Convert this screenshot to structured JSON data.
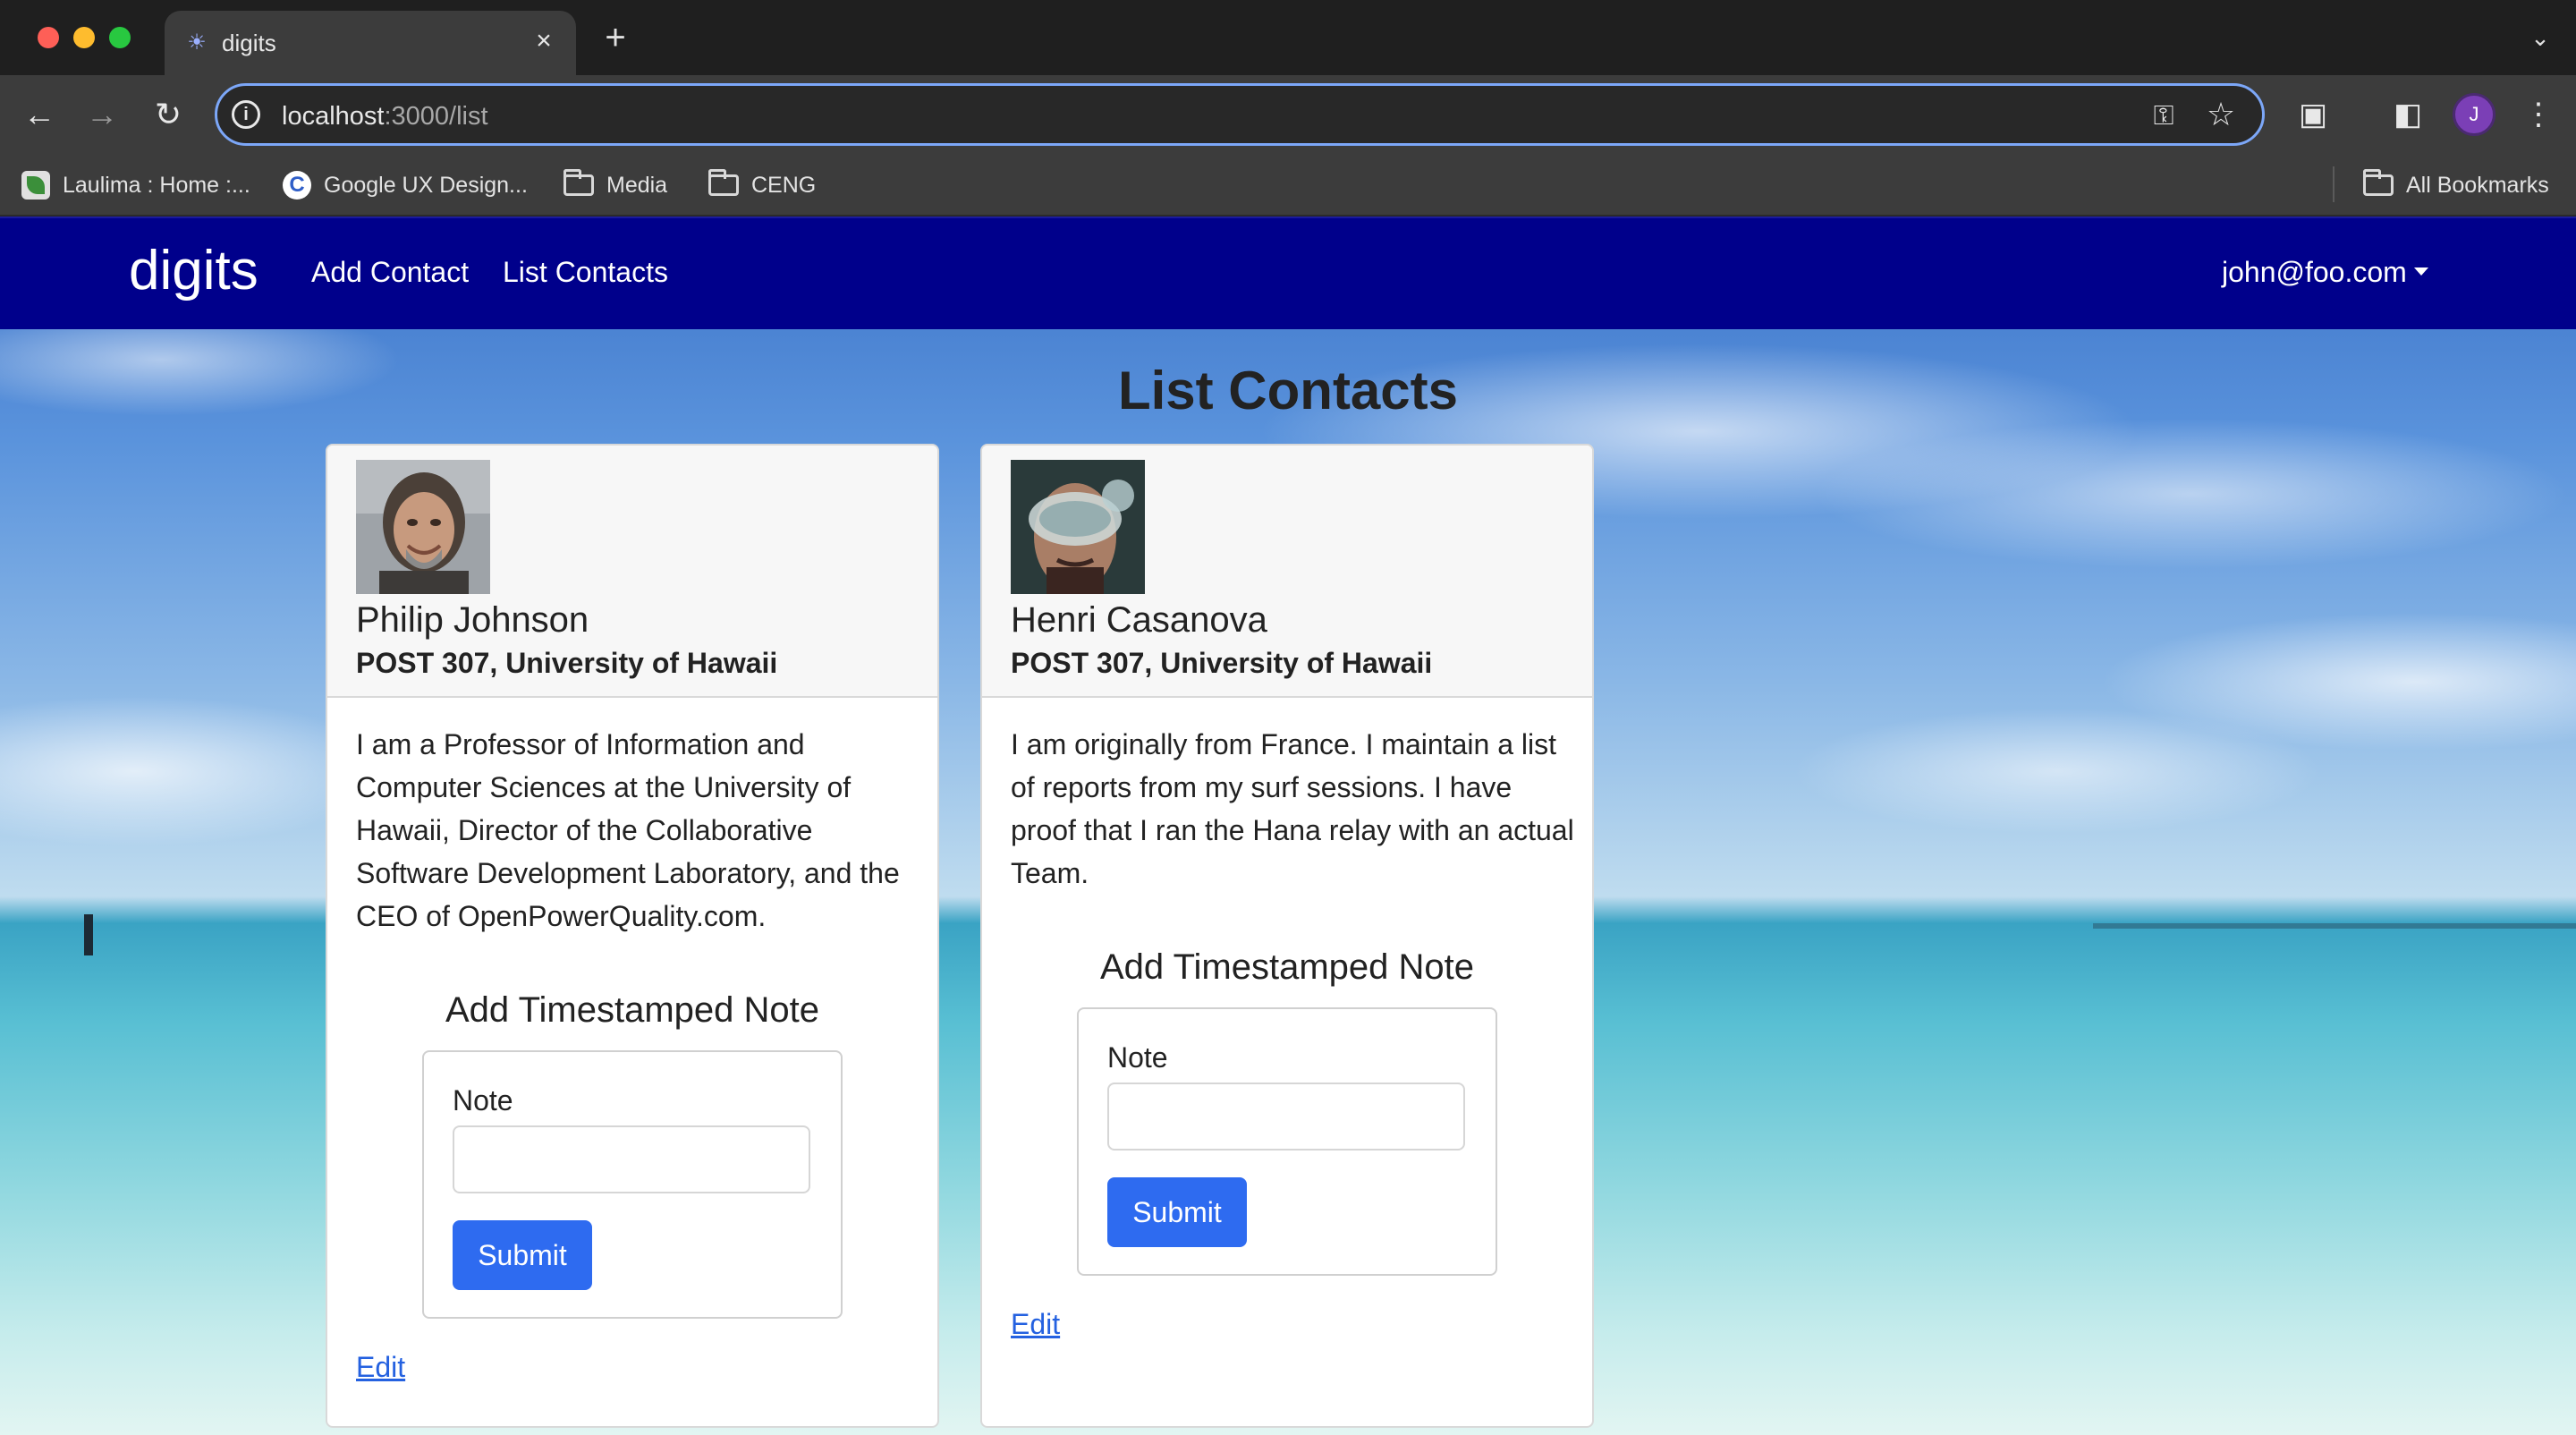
{
  "browser": {
    "tab_title": "digits",
    "url_host": "localhost",
    "url_path": ":3000/list",
    "avatar_initial": "J",
    "bookmarks": [
      {
        "label": "Laulima : Home :...",
        "icon": "laulima-leaf-icon"
      },
      {
        "label": "Google UX Design...",
        "icon": "google-c-icon"
      },
      {
        "label": "Media",
        "icon": "folder-icon"
      },
      {
        "label": "CENG",
        "icon": "folder-icon"
      }
    ],
    "all_bookmarks": "All Bookmarks"
  },
  "navbar": {
    "brand": "digits",
    "links": [
      "Add Contact",
      "List Contacts"
    ],
    "user": "john@foo.com",
    "background": "#00008b"
  },
  "page": {
    "title": "List Contacts"
  },
  "contacts": [
    {
      "name": "Philip Johnson",
      "address": "POST 307, University of Hawaii",
      "description": "I am a Professor of Information and Computer Sciences at the University of Hawaii, Director of the Collaborative Software Development Laboratory, and the CEO of OpenPowerQuality.com.",
      "note_title": "Add Timestamped Note",
      "note_label": "Note",
      "note_value": "",
      "submit_label": "Submit",
      "edit_label": "Edit"
    },
    {
      "name": "Henri Casanova",
      "address": "POST 307, University of Hawaii",
      "description": "I am originally from France. I maintain a list of reports from my surf sessions. I have proof that I ran the Hana relay with an actual Team.",
      "note_title": "Add Timestamped Note",
      "note_label": "Note",
      "note_value": "",
      "submit_label": "Submit",
      "edit_label": "Edit"
    }
  ],
  "colors": {
    "submit_button": "#2e6bf0",
    "link": "#2461e0"
  }
}
